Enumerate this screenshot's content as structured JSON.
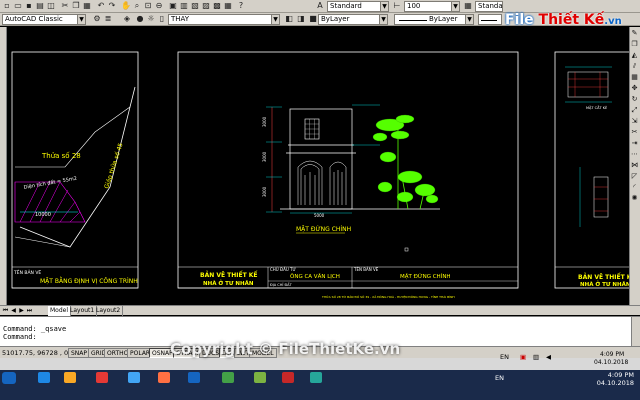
{
  "toolbar1": {
    "textstyle_value": "Standard",
    "dimstyle_value": "100",
    "linetype_label": "ByLayer",
    "tablestyle_value": "Standard"
  },
  "toolbar2": {
    "workspace_value": "AutoCAD Classic",
    "layer_value": "THAY",
    "color_value": "ByLayer",
    "linetype_value": "ByLayer"
  },
  "logo": {
    "part1": "File",
    "part2": "Thiết Kế",
    "part3": ".vn"
  },
  "drawing": {
    "sheet_left": {
      "label_parcel": "Thửa số 28",
      "label_road": "Giáp thửa số 45",
      "label_area": "Diện tích đất = 55m2",
      "dimension": "10000",
      "title_small": "TÊN BẢN VẼ",
      "title_main": "MẶT BẰNG ĐỊNH VỊ CÔNG TRÌNH"
    },
    "sheet_center": {
      "elevation_caption": "MẶT ĐỨNG CHÍNH",
      "dim_top": "3000",
      "dim_mid": "3000",
      "dim_bottom": "3000",
      "dim_width": "5000",
      "project_title_line1": "BẢN VẼ THIẾT KẾ",
      "project_title_line2": "NHÀ Ở TƯ NHÂN",
      "owner_label": "CHỦ ĐẦU TƯ",
      "owner_value": "ÔNG CA VĂN LỊCH",
      "drawing_name_label": "TÊN BẢN VẼ",
      "drawing_name_value": "MẶT ĐỨNG CHÍNH",
      "address_label": "ĐỊA CHỈ ĐẤT",
      "footer_note": "THỬA SỐ 28 TỜ BẢN ĐỒ SỐ 39 - XÃ ĐÔNG HOÀ - HUYỆN ĐÔNG HƯNG - TỈNH THÁI BÌNH"
    },
    "sheet_right": {
      "caption": "MẶT CẮT KÈ",
      "project_title_line1": "BẢN VẼ THIẾT KẾ",
      "project_title_line2": "NHÀ Ở TƯ NHÂN"
    }
  },
  "tabs": {
    "model": "Model",
    "layout1": "Layout1",
    "layout2": "Layout2"
  },
  "command": {
    "history_line": "Command: _qsave",
    "prompt": "Command:"
  },
  "status": {
    "coords": "51017.75, 96728 , 0",
    "buttons": [
      "SNAP",
      "GRID",
      "ORTHO",
      "POLAR",
      "OSNAP",
      "OTRACK",
      "DUCS",
      "DYN",
      "LWT",
      "MODEL"
    ]
  },
  "tray_upper": {
    "lang": "EN",
    "time": "4:09 PM",
    "date": "04.10.2018"
  },
  "tray_lower": {
    "lang": "EN",
    "time": "4:09 PM",
    "date": "04.10.2018"
  },
  "watermark": "Copyright © FileThietKe.vn",
  "colors": {
    "canvas_bg": "#000000",
    "frame_white": "#ffffff",
    "title_yellow": "#ffff00",
    "line_cyan": "#00ffff",
    "tree_green": "#55ff00",
    "magenta": "#ff00ff",
    "toolbar_gray": "#d4d0c8"
  }
}
